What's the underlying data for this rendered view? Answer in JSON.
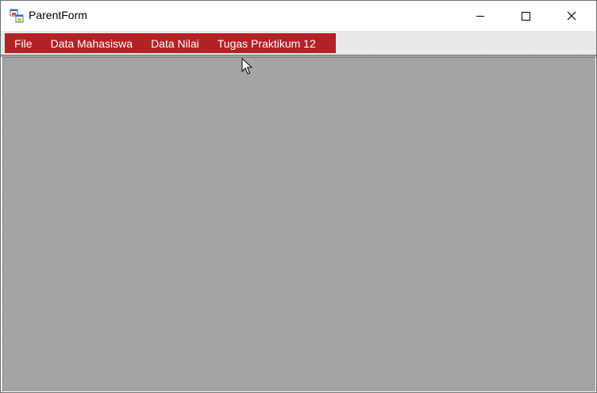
{
  "window": {
    "title": "ParentForm",
    "controls": {
      "minimize": "minimize-icon",
      "maximize": "maximize-icon",
      "close": "close-icon"
    }
  },
  "menu": {
    "background_color": "#b22325",
    "text_color": "#ffffff",
    "items": [
      {
        "label": "File"
      },
      {
        "label": "Data Mahasiswa"
      },
      {
        "label": "Data Nilai"
      },
      {
        "label": "Tugas Praktikum 12"
      }
    ]
  },
  "mdi_client": {
    "color": "#acacac"
  }
}
